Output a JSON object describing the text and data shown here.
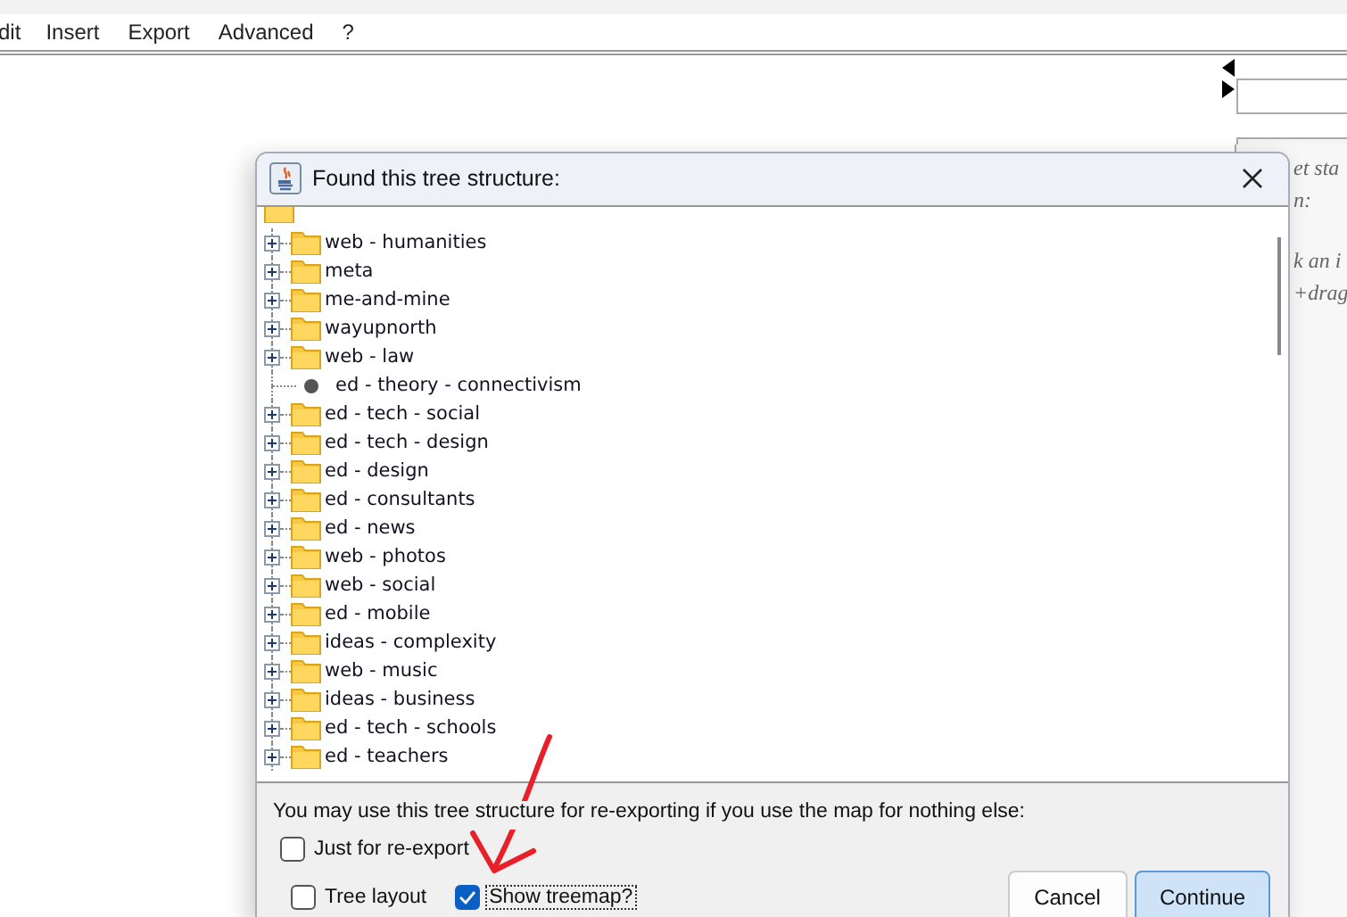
{
  "menu": [
    "dit",
    "Insert",
    "Export",
    "Advanced",
    "?"
  ],
  "side_panel": {
    "hints": [
      "et sta",
      "n:",
      "k an i",
      "+drag"
    ]
  },
  "dialog": {
    "title": "Found this tree structure:",
    "tree": {
      "root": {
        "kind": "folder"
      },
      "children": [
        {
          "label": "web - humanities",
          "kind": "folder",
          "expanded": false
        },
        {
          "label": "meta",
          "kind": "folder",
          "expanded": false
        },
        {
          "label": "me-and-mine",
          "kind": "folder",
          "expanded": false
        },
        {
          "label": "wayupnorth",
          "kind": "folder",
          "expanded": false
        },
        {
          "label": "web - law",
          "kind": "folder",
          "expanded": false
        },
        {
          "label": "ed - theory - connectivism",
          "kind": "leaf"
        },
        {
          "label": "ed - tech - social",
          "kind": "folder",
          "expanded": false
        },
        {
          "label": "ed - tech - design",
          "kind": "folder",
          "expanded": false
        },
        {
          "label": "ed - design",
          "kind": "folder",
          "expanded": false
        },
        {
          "label": "ed - consultants",
          "kind": "folder",
          "expanded": false
        },
        {
          "label": "ed - news",
          "kind": "folder",
          "expanded": false
        },
        {
          "label": "web - photos",
          "kind": "folder",
          "expanded": false
        },
        {
          "label": "web - social",
          "kind": "folder",
          "expanded": false
        },
        {
          "label": "ed - mobile",
          "kind": "folder",
          "expanded": false
        },
        {
          "label": "ideas - complexity",
          "kind": "folder",
          "expanded": false
        },
        {
          "label": "web - music",
          "kind": "folder",
          "expanded": false
        },
        {
          "label": "ideas - business",
          "kind": "folder",
          "expanded": false
        },
        {
          "label": "ed - tech - schools",
          "kind": "folder",
          "expanded": false
        },
        {
          "label": "ed - teachers",
          "kind": "folder",
          "expanded": false
        }
      ]
    },
    "message": "You may use this tree structure for re-exporting if you use the map for nothing else:",
    "options": [
      {
        "label": "Just for re-export",
        "checked": false,
        "focused": false
      },
      {
        "label": "Tree layout",
        "checked": false,
        "focused": false
      },
      {
        "label": "Show treemap?",
        "checked": true,
        "focused": true
      }
    ],
    "buttons": [
      {
        "label": "Cancel",
        "default": false
      },
      {
        "label": "Continue",
        "default": true
      }
    ]
  }
}
